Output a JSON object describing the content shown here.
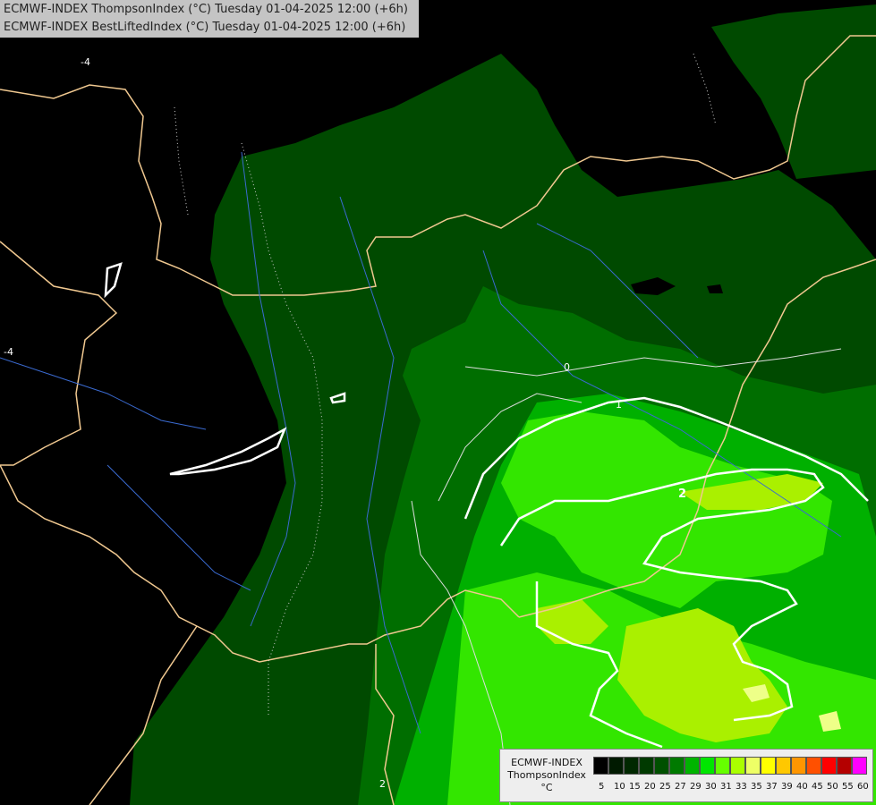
{
  "header": {
    "line1": "ECMWF-INDEX ThompsonIndex (°C) Tuesday 01-04-2025 12:00 (+6h)",
    "line2": "ECMWF-INDEX BestLiftedIndex (°C) Tuesday 01-04-2025 12:00 (+6h)"
  },
  "legend": {
    "name_line1": "ECMWF-INDEX",
    "name_line2": "ThompsonIndex",
    "name_line3": "°C",
    "colors": [
      "#000000",
      "#001a00",
      "#002800",
      "#003a00",
      "#005000",
      "#007a00",
      "#00b400",
      "#00e600",
      "#66ff00",
      "#aaff00",
      "#eeff66",
      "#ffff00",
      "#ffc800",
      "#ff9600",
      "#ff5000",
      "#ff0000",
      "#b40000",
      "#ff00ff",
      "#c800ff",
      "#8000ff",
      "#5000ff",
      "#0000ff"
    ],
    "ticks": [
      "5",
      "10",
      "15",
      "20",
      "25",
      "27",
      "29",
      "30",
      "31",
      "33",
      "35",
      "37",
      "39",
      "40",
      "45",
      "50",
      "55",
      "60"
    ]
  },
  "contour_labels": [
    "-4",
    "-4",
    "0",
    "1",
    "2",
    "2"
  ]
}
